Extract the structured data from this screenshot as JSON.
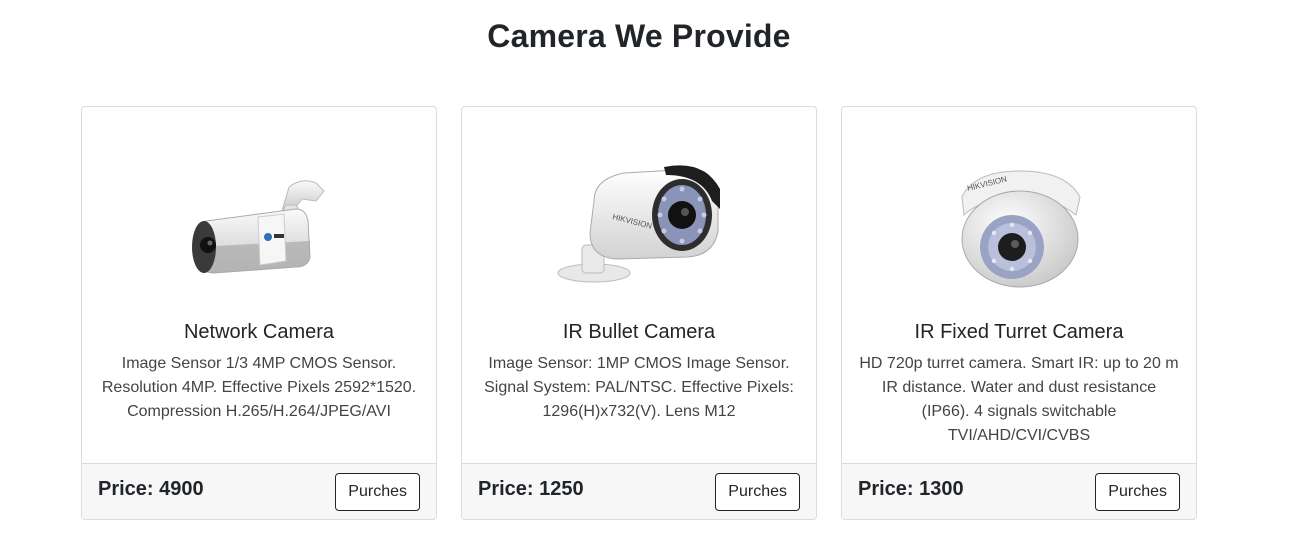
{
  "section": {
    "title": "Camera We Provide"
  },
  "products": [
    {
      "name": "Network Camera",
      "description": "Image Sensor 1/3 4MP CMOS Sensor. Resolution 4MP. Effective Pixels 2592*1520. Compression H.265/H.264/JPEG/AVI",
      "price": "Price: 4900",
      "button_label": "Purches",
      "image_icon": "bullet-camera-icon"
    },
    {
      "name": "IR Bullet Camera",
      "description": "Image Sensor: 1MP CMOS Image Sensor. Signal System: PAL/NTSC. Effective Pixels: 1296(H)x732(V). Lens M12",
      "price": "Price: 1250",
      "button_label": "Purches",
      "image_icon": "ir-bullet-camera-icon",
      "brand_text": "HIKVISION"
    },
    {
      "name": "IR Fixed Turret Camera",
      "description": "HD 720p turret camera. Smart IR: up to 20 m IR distance. Water and dust resistance (IP66). 4 signals switchable TVI/AHD/CVI/CVBS",
      "price": "Price: 1300",
      "button_label": "Purches",
      "image_icon": "turret-camera-icon",
      "brand_text": "HIKVISION"
    }
  ]
}
